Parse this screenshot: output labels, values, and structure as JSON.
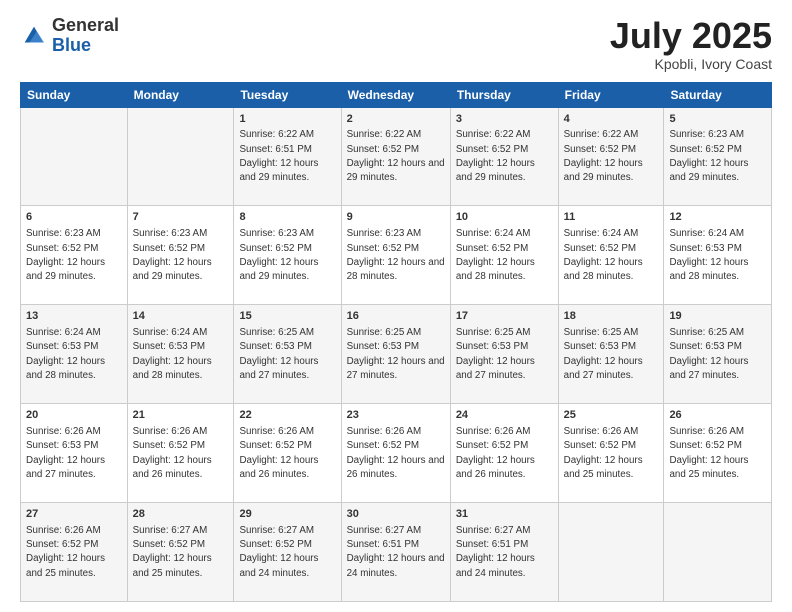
{
  "logo": {
    "general": "General",
    "blue": "Blue"
  },
  "header": {
    "title": "July 2025",
    "subtitle": "Kpobli, Ivory Coast"
  },
  "days_of_week": [
    "Sunday",
    "Monday",
    "Tuesday",
    "Wednesday",
    "Thursday",
    "Friday",
    "Saturday"
  ],
  "weeks": [
    [
      {
        "day": "",
        "sunrise": "",
        "sunset": "",
        "daylight": ""
      },
      {
        "day": "",
        "sunrise": "",
        "sunset": "",
        "daylight": ""
      },
      {
        "day": "1",
        "sunrise": "Sunrise: 6:22 AM",
        "sunset": "Sunset: 6:51 PM",
        "daylight": "Daylight: 12 hours and 29 minutes."
      },
      {
        "day": "2",
        "sunrise": "Sunrise: 6:22 AM",
        "sunset": "Sunset: 6:52 PM",
        "daylight": "Daylight: 12 hours and 29 minutes."
      },
      {
        "day": "3",
        "sunrise": "Sunrise: 6:22 AM",
        "sunset": "Sunset: 6:52 PM",
        "daylight": "Daylight: 12 hours and 29 minutes."
      },
      {
        "day": "4",
        "sunrise": "Sunrise: 6:22 AM",
        "sunset": "Sunset: 6:52 PM",
        "daylight": "Daylight: 12 hours and 29 minutes."
      },
      {
        "day": "5",
        "sunrise": "Sunrise: 6:23 AM",
        "sunset": "Sunset: 6:52 PM",
        "daylight": "Daylight: 12 hours and 29 minutes."
      }
    ],
    [
      {
        "day": "6",
        "sunrise": "Sunrise: 6:23 AM",
        "sunset": "Sunset: 6:52 PM",
        "daylight": "Daylight: 12 hours and 29 minutes."
      },
      {
        "day": "7",
        "sunrise": "Sunrise: 6:23 AM",
        "sunset": "Sunset: 6:52 PM",
        "daylight": "Daylight: 12 hours and 29 minutes."
      },
      {
        "day": "8",
        "sunrise": "Sunrise: 6:23 AM",
        "sunset": "Sunset: 6:52 PM",
        "daylight": "Daylight: 12 hours and 29 minutes."
      },
      {
        "day": "9",
        "sunrise": "Sunrise: 6:23 AM",
        "sunset": "Sunset: 6:52 PM",
        "daylight": "Daylight: 12 hours and 28 minutes."
      },
      {
        "day": "10",
        "sunrise": "Sunrise: 6:24 AM",
        "sunset": "Sunset: 6:52 PM",
        "daylight": "Daylight: 12 hours and 28 minutes."
      },
      {
        "day": "11",
        "sunrise": "Sunrise: 6:24 AM",
        "sunset": "Sunset: 6:52 PM",
        "daylight": "Daylight: 12 hours and 28 minutes."
      },
      {
        "day": "12",
        "sunrise": "Sunrise: 6:24 AM",
        "sunset": "Sunset: 6:53 PM",
        "daylight": "Daylight: 12 hours and 28 minutes."
      }
    ],
    [
      {
        "day": "13",
        "sunrise": "Sunrise: 6:24 AM",
        "sunset": "Sunset: 6:53 PM",
        "daylight": "Daylight: 12 hours and 28 minutes."
      },
      {
        "day": "14",
        "sunrise": "Sunrise: 6:24 AM",
        "sunset": "Sunset: 6:53 PM",
        "daylight": "Daylight: 12 hours and 28 minutes."
      },
      {
        "day": "15",
        "sunrise": "Sunrise: 6:25 AM",
        "sunset": "Sunset: 6:53 PM",
        "daylight": "Daylight: 12 hours and 27 minutes."
      },
      {
        "day": "16",
        "sunrise": "Sunrise: 6:25 AM",
        "sunset": "Sunset: 6:53 PM",
        "daylight": "Daylight: 12 hours and 27 minutes."
      },
      {
        "day": "17",
        "sunrise": "Sunrise: 6:25 AM",
        "sunset": "Sunset: 6:53 PM",
        "daylight": "Daylight: 12 hours and 27 minutes."
      },
      {
        "day": "18",
        "sunrise": "Sunrise: 6:25 AM",
        "sunset": "Sunset: 6:53 PM",
        "daylight": "Daylight: 12 hours and 27 minutes."
      },
      {
        "day": "19",
        "sunrise": "Sunrise: 6:25 AM",
        "sunset": "Sunset: 6:53 PM",
        "daylight": "Daylight: 12 hours and 27 minutes."
      }
    ],
    [
      {
        "day": "20",
        "sunrise": "Sunrise: 6:26 AM",
        "sunset": "Sunset: 6:53 PM",
        "daylight": "Daylight: 12 hours and 27 minutes."
      },
      {
        "day": "21",
        "sunrise": "Sunrise: 6:26 AM",
        "sunset": "Sunset: 6:52 PM",
        "daylight": "Daylight: 12 hours and 26 minutes."
      },
      {
        "day": "22",
        "sunrise": "Sunrise: 6:26 AM",
        "sunset": "Sunset: 6:52 PM",
        "daylight": "Daylight: 12 hours and 26 minutes."
      },
      {
        "day": "23",
        "sunrise": "Sunrise: 6:26 AM",
        "sunset": "Sunset: 6:52 PM",
        "daylight": "Daylight: 12 hours and 26 minutes."
      },
      {
        "day": "24",
        "sunrise": "Sunrise: 6:26 AM",
        "sunset": "Sunset: 6:52 PM",
        "daylight": "Daylight: 12 hours and 26 minutes."
      },
      {
        "day": "25",
        "sunrise": "Sunrise: 6:26 AM",
        "sunset": "Sunset: 6:52 PM",
        "daylight": "Daylight: 12 hours and 25 minutes."
      },
      {
        "day": "26",
        "sunrise": "Sunrise: 6:26 AM",
        "sunset": "Sunset: 6:52 PM",
        "daylight": "Daylight: 12 hours and 25 minutes."
      }
    ],
    [
      {
        "day": "27",
        "sunrise": "Sunrise: 6:26 AM",
        "sunset": "Sunset: 6:52 PM",
        "daylight": "Daylight: 12 hours and 25 minutes."
      },
      {
        "day": "28",
        "sunrise": "Sunrise: 6:27 AM",
        "sunset": "Sunset: 6:52 PM",
        "daylight": "Daylight: 12 hours and 25 minutes."
      },
      {
        "day": "29",
        "sunrise": "Sunrise: 6:27 AM",
        "sunset": "Sunset: 6:52 PM",
        "daylight": "Daylight: 12 hours and 24 minutes."
      },
      {
        "day": "30",
        "sunrise": "Sunrise: 6:27 AM",
        "sunset": "Sunset: 6:51 PM",
        "daylight": "Daylight: 12 hours and 24 minutes."
      },
      {
        "day": "31",
        "sunrise": "Sunrise: 6:27 AM",
        "sunset": "Sunset: 6:51 PM",
        "daylight": "Daylight: 12 hours and 24 minutes."
      },
      {
        "day": "",
        "sunrise": "",
        "sunset": "",
        "daylight": ""
      },
      {
        "day": "",
        "sunrise": "",
        "sunset": "",
        "daylight": ""
      }
    ]
  ]
}
